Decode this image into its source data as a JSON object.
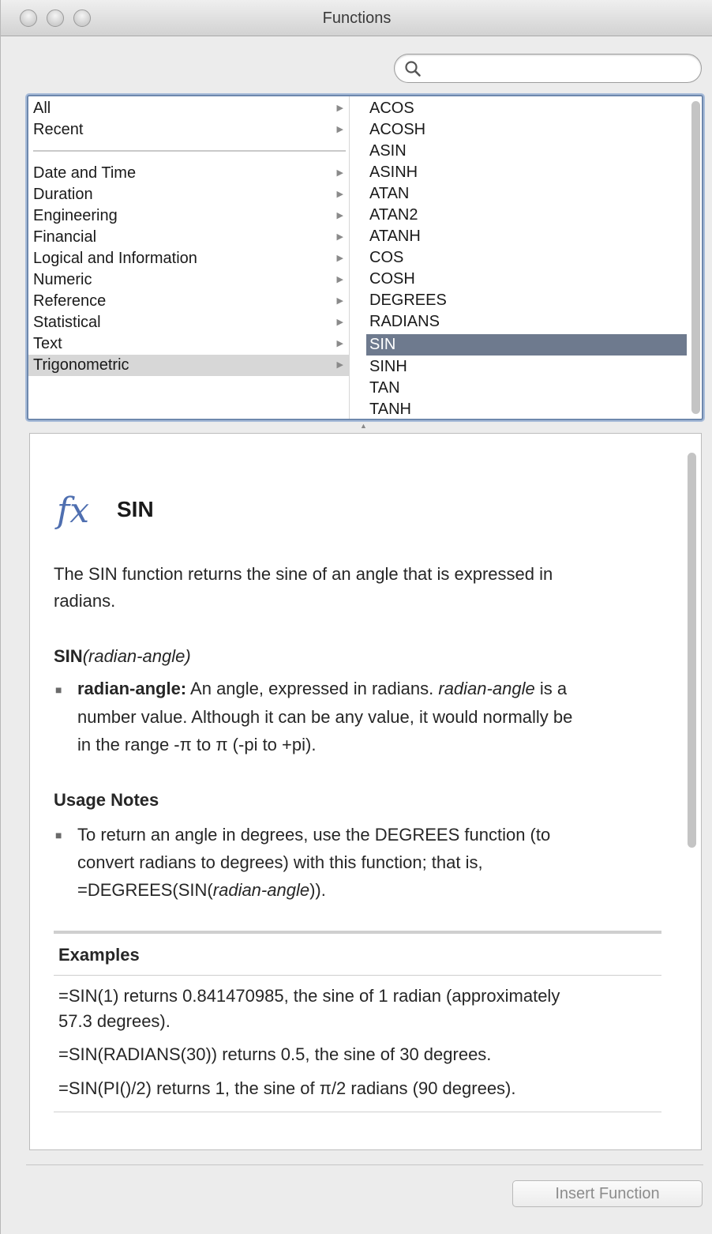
{
  "window": {
    "title": "Functions"
  },
  "search": {
    "placeholder": "",
    "value": ""
  },
  "categories": [
    {
      "label": "All",
      "selected": false
    },
    {
      "label": "Recent",
      "selected": false
    },
    {
      "label": "Date and Time",
      "selected": false
    },
    {
      "label": "Duration",
      "selected": false
    },
    {
      "label": "Engineering",
      "selected": false
    },
    {
      "label": "Financial",
      "selected": false
    },
    {
      "label": "Logical and Information",
      "selected": false
    },
    {
      "label": "Numeric",
      "selected": false
    },
    {
      "label": "Reference",
      "selected": false
    },
    {
      "label": "Statistical",
      "selected": false
    },
    {
      "label": "Text",
      "selected": false
    },
    {
      "label": "Trigonometric",
      "selected": true
    }
  ],
  "functions": [
    "ACOS",
    "ACOSH",
    "ASIN",
    "ASINH",
    "ATAN",
    "ATAN2",
    "ATANH",
    "COS",
    "COSH",
    "DEGREES",
    "RADIANS",
    "SIN",
    "SINH",
    "TAN",
    "TANH"
  ],
  "selected_function": "SIN",
  "description": {
    "fx_symbol": "fx",
    "name": "SIN",
    "summary_line1": "The SIN function returns the sine of an angle that is expressed in",
    "summary_line2": "radians.",
    "syntax_name": "SIN",
    "syntax_arg": "(radian-angle)",
    "arg_name": "radian-angle:",
    "arg_line1_a": "An angle, expressed in radians.",
    "arg_line1_b": "radian-angle",
    "arg_line1_c": "is a",
    "arg_line2": "number value. Although it can be any value, it would normally be",
    "arg_line3": "in the range -π to π (-pi to +pi).",
    "usage_heading": "Usage Notes",
    "usage_line1": "To return an angle in degrees, use the DEGREES function (to",
    "usage_line2": "convert radians to degrees) with this function; that is,",
    "usage_line3_a": "=DEGREES(SIN(",
    "usage_line3_b": "radian-angle",
    "usage_line3_c": ")).",
    "examples_heading": "Examples",
    "examples": [
      "=SIN(1) returns 0.841470985, the sine of 1 radian (approximately",
      "57.3 degrees).",
      "=SIN(RADIANS(30)) returns 0.5, the sine of 30 degrees.",
      "=SIN(PI()/2) returns 1, the sine of π/2 radians (90 degrees)."
    ]
  },
  "footer": {
    "insert_label": "Insert Function"
  }
}
